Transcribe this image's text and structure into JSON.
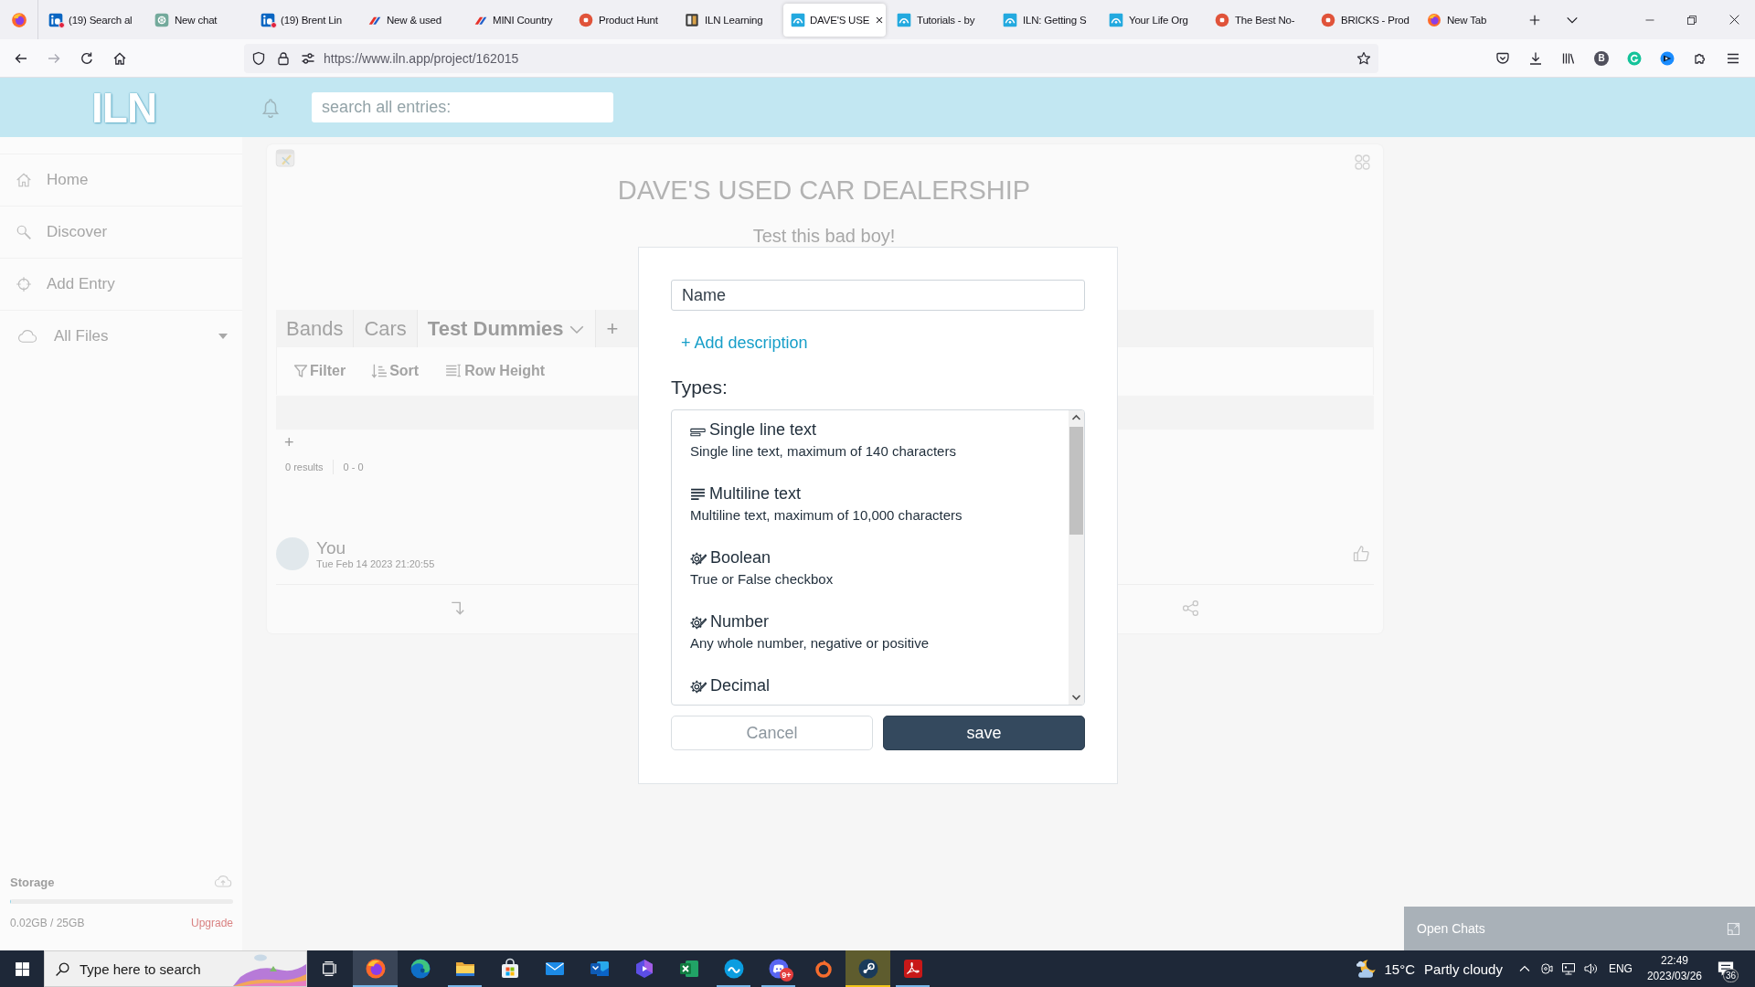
{
  "browser": {
    "tabs": [
      {
        "title": "(19) Search al",
        "kind": "in-tile",
        "unread": true,
        "selected": false
      },
      {
        "title": "New chat",
        "kind": "knot",
        "unread": false,
        "selected": false
      },
      {
        "title": "(19) Brent Lin",
        "kind": "in-tile",
        "unread": true,
        "selected": false
      },
      {
        "title": "New & used",
        "kind": "stripes",
        "unread": false,
        "selected": false
      },
      {
        "title": "MINI Country",
        "kind": "stripes",
        "unread": false,
        "selected": false
      },
      {
        "title": "Product Hunt",
        "kind": "p-disc",
        "unread": false,
        "selected": false
      },
      {
        "title": "ILN Learning",
        "kind": "book",
        "unread": false,
        "selected": false
      },
      {
        "title": "DAVE'S USE",
        "kind": "iln-tile",
        "unread": false,
        "selected": true
      },
      {
        "title": "Tutorials - by",
        "kind": "iln-tile",
        "unread": false,
        "selected": false
      },
      {
        "title": "ILN: Getting S",
        "kind": "iln-tile",
        "unread": false,
        "selected": false
      },
      {
        "title": "Your Life Org",
        "kind": "iln-tile",
        "unread": false,
        "selected": false
      },
      {
        "title": "The Best No-",
        "kind": "p-disc",
        "unread": false,
        "selected": false
      },
      {
        "title": "BRICKS - Prod",
        "kind": "p-disc",
        "unread": false,
        "selected": false
      },
      {
        "title": "New Tab",
        "kind": "fox-globe",
        "unread": false,
        "selected": false
      }
    ],
    "url": "https://www.iln.app/project/162015",
    "profile_letter": "B"
  },
  "app": {
    "logo": "ILN",
    "search": {
      "placeholder": "search all entries:"
    }
  },
  "sidebar": {
    "items": [
      {
        "label": "Home",
        "kind": "home",
        "dropdown": false
      },
      {
        "label": "Discover",
        "kind": "discover",
        "dropdown": false
      },
      {
        "label": "Add Entry",
        "kind": "add",
        "dropdown": false
      },
      {
        "label": "All Files",
        "kind": "files",
        "dropdown": true
      }
    ],
    "storage": {
      "title": "Storage",
      "level": 0.001,
      "usage": "0.02GB / 25GB",
      "upgrade": "Upgrade"
    }
  },
  "project": {
    "title": "DAVE'S USED CAR DEALERSHIP",
    "subtitle": "Test this bad boy!",
    "tabs": [
      {
        "label": "Bands",
        "selected": false
      },
      {
        "label": "Cars",
        "selected": false
      },
      {
        "label": "Test Dummies",
        "selected": true
      }
    ],
    "add_tab": "+",
    "tools": [
      {
        "label": "Filter",
        "kind": "filter"
      },
      {
        "label": "Sort",
        "kind": "sort"
      },
      {
        "label": "Row Height",
        "kind": "rows"
      }
    ],
    "add_row": "+",
    "results": "0 results",
    "range": "0 - 0",
    "comment": {
      "author": "You",
      "time": "Tue Feb 14 2023 21:20:55"
    }
  },
  "dialog": {
    "name_field": {
      "placeholder": "Name"
    },
    "add_description": "+ Add description",
    "types_heading": "Types:",
    "types": [
      {
        "name": "Single line text",
        "description": "Single line text, maximum of 140 characters",
        "kind": "line"
      },
      {
        "name": "Multiline text",
        "description": "Multiline text, maximum of 10,000 characters",
        "kind": "lines"
      },
      {
        "name": "Boolean",
        "description": "True or False checkbox",
        "kind": "gear"
      },
      {
        "name": "Number",
        "description": "Any whole number, negative or positive",
        "kind": "gear"
      },
      {
        "name": "Decimal",
        "kind": "gear"
      }
    ],
    "buttons": [
      {
        "label": "Cancel",
        "kind": "secondary"
      },
      {
        "label": "save",
        "kind": "primary"
      }
    ]
  },
  "chats": {
    "label": "Open Chats"
  },
  "taskbar": {
    "search": {
      "placeholder": "Type here to search"
    },
    "apps": [
      {
        "kind": "fox-globe",
        "running": true,
        "active": true,
        "attention": false
      },
      {
        "kind": "wave",
        "running": false,
        "active": false,
        "attention": false
      },
      {
        "kind": "folder",
        "running": true,
        "active": false,
        "attention": false
      },
      {
        "kind": "bag",
        "running": false,
        "active": false,
        "attention": false
      },
      {
        "kind": "envelope",
        "running": false,
        "active": false,
        "attention": false
      },
      {
        "kind": "mail-tile",
        "running": false,
        "active": false,
        "attention": false
      },
      {
        "kind": "hexagon",
        "running": false,
        "active": false,
        "attention": false
      },
      {
        "kind": "sheet",
        "running": false,
        "active": false,
        "attention": false
      },
      {
        "kind": "s-disc",
        "running": true,
        "active": false,
        "attention": false
      },
      {
        "kind": "pad",
        "running": true,
        "active": false,
        "attention": false,
        "badge": "9+"
      },
      {
        "kind": "ring",
        "running": false,
        "active": false,
        "attention": false
      },
      {
        "kind": "piston",
        "running": true,
        "active": false,
        "attention": true
      },
      {
        "kind": "doc",
        "running": true,
        "active": false,
        "attention": false
      }
    ],
    "weather": {
      "temperature": "15°C",
      "condition": "Partly cloudy"
    },
    "language": "ENG",
    "time": "22:49",
    "date": "2023/03/26",
    "notifications": "36"
  }
}
